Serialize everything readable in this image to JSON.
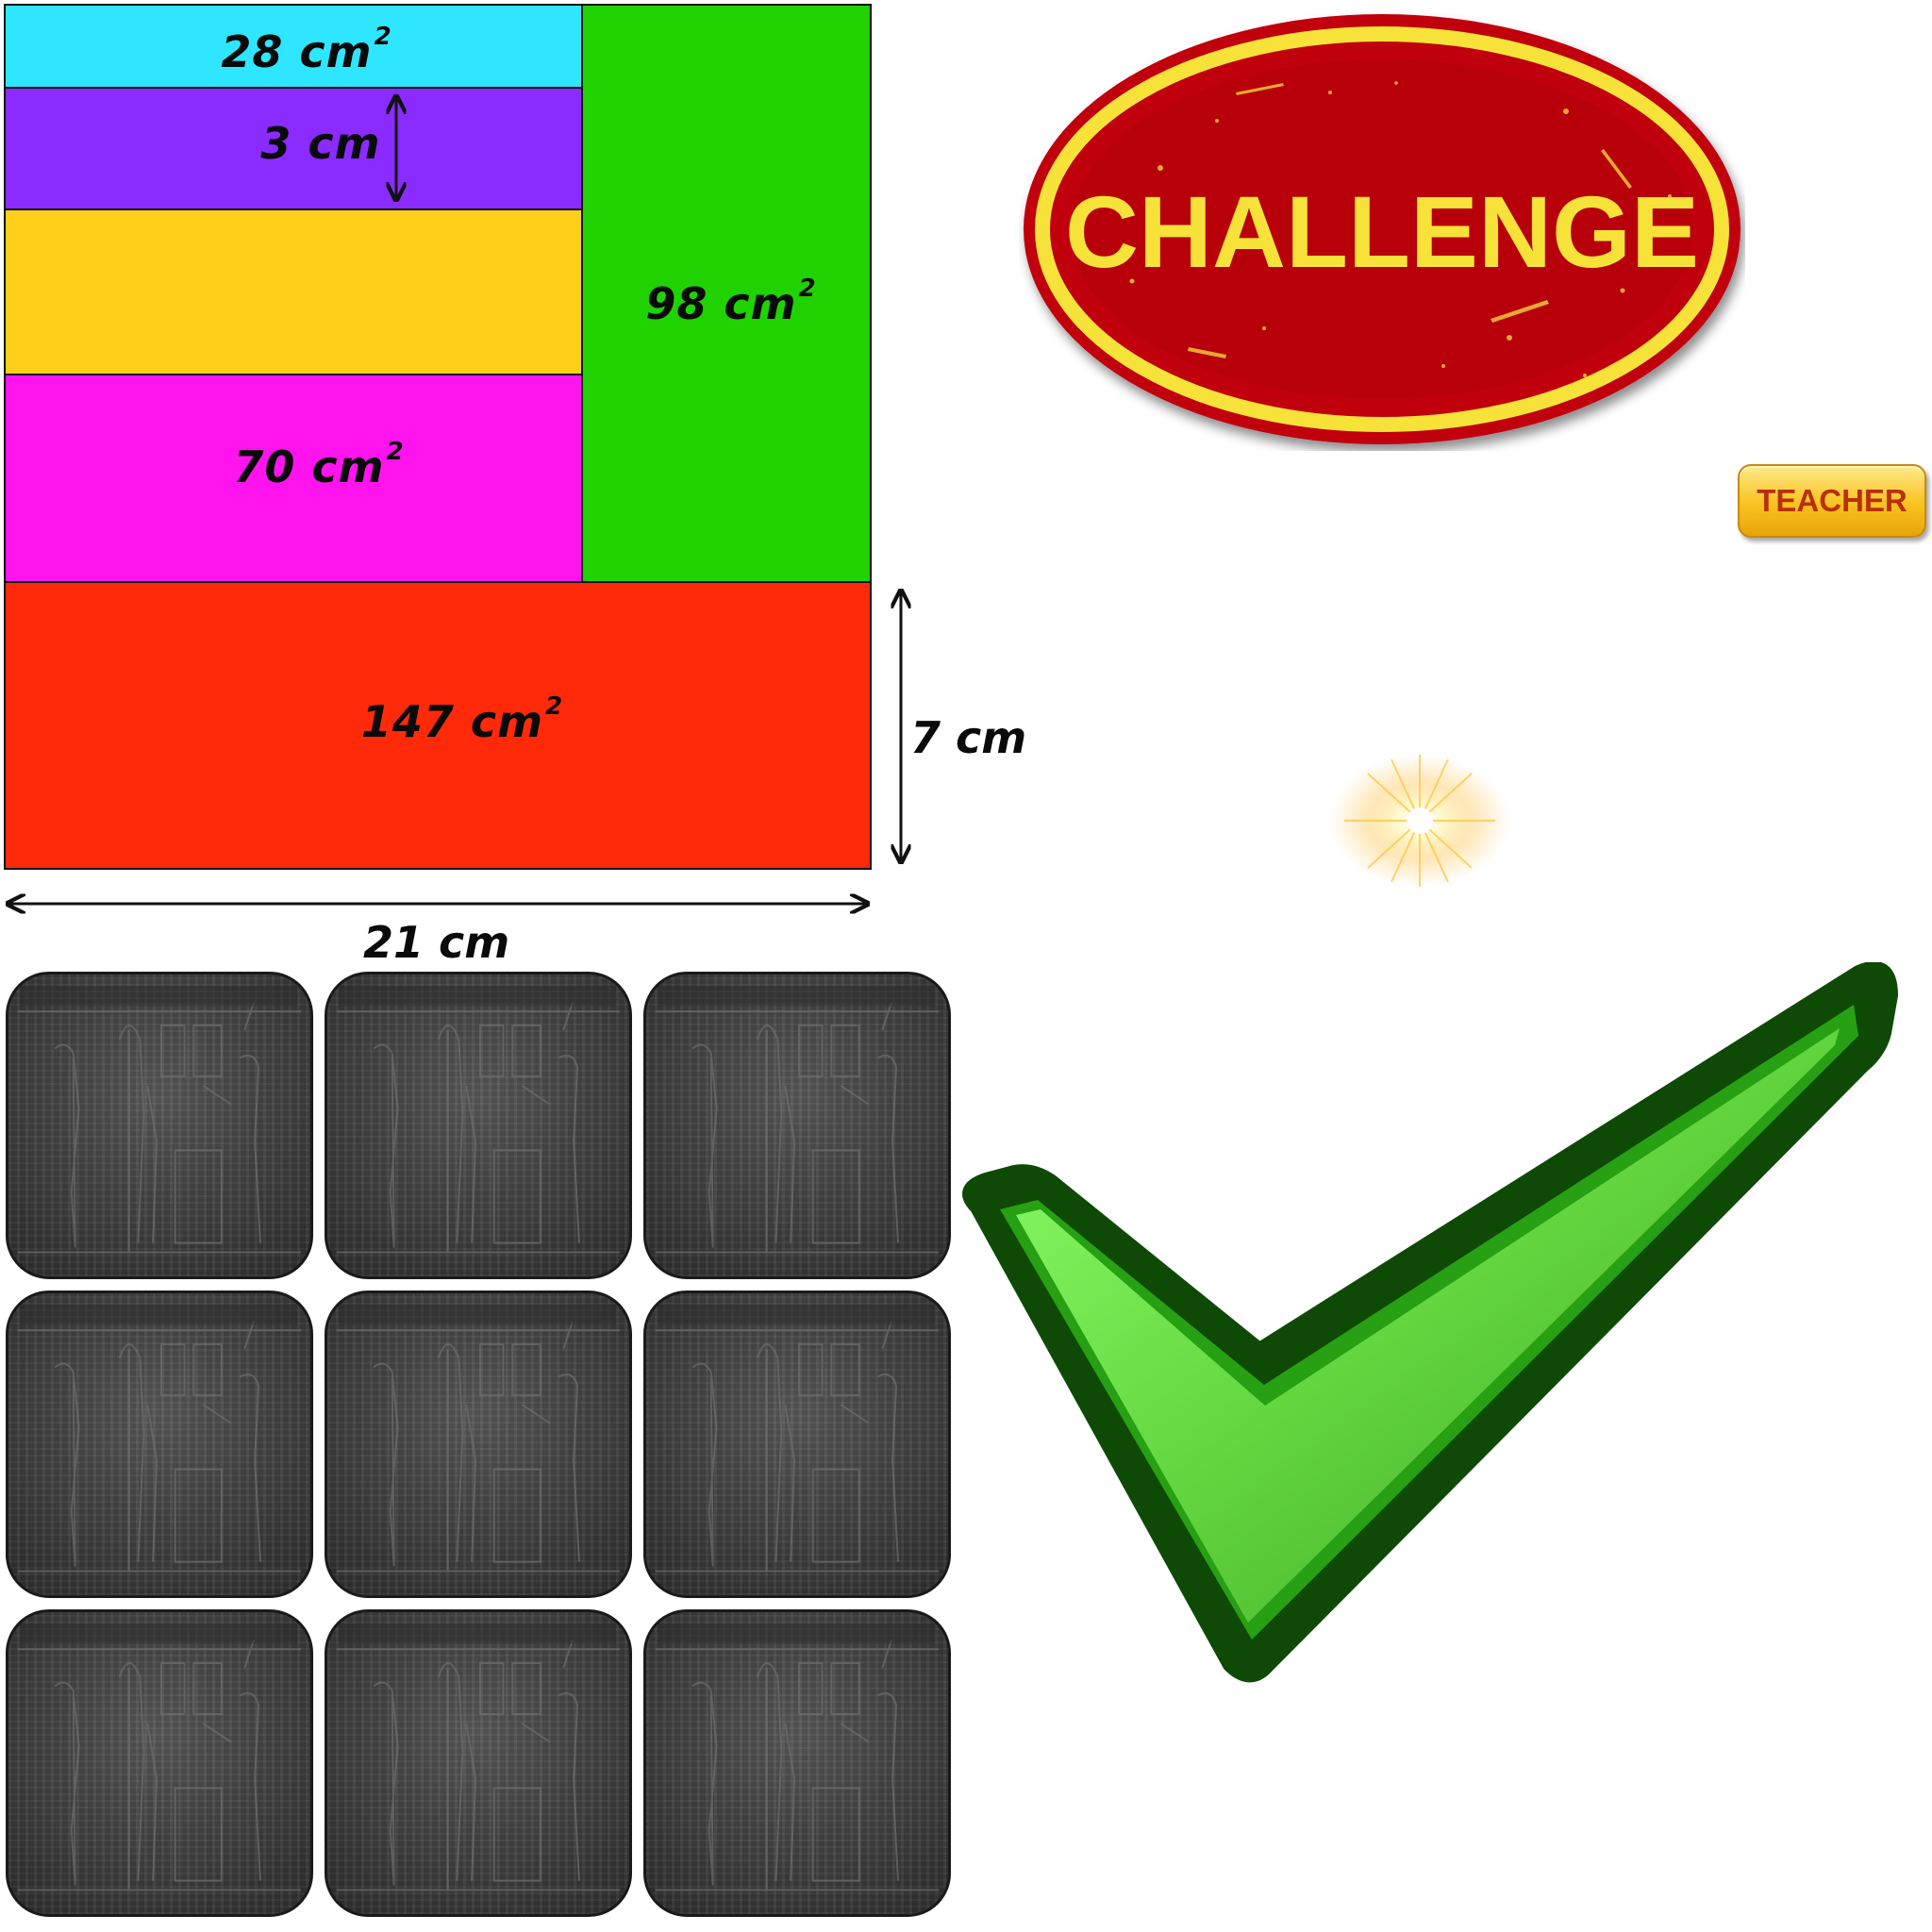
{
  "diagram": {
    "rectangles": [
      {
        "id": "cyan",
        "color": "#2ee6ff",
        "area_label": "28 cm",
        "superscript": "2"
      },
      {
        "id": "purple",
        "color": "#8a2bff",
        "height_label": "3 cm"
      },
      {
        "id": "yellow",
        "color": "#ffcf1a"
      },
      {
        "id": "magenta",
        "color": "#ff14ee",
        "area_label": "70 cm",
        "superscript": "2"
      },
      {
        "id": "green",
        "color": "#1fd200",
        "area_label": "98 cm",
        "superscript": "2"
      },
      {
        "id": "red",
        "color": "#ff2a0a",
        "area_label": "147 cm",
        "superscript": "2"
      }
    ],
    "height_dimension": "7 cm",
    "width_dimension": "21 cm"
  },
  "badge": {
    "text": "CHALLENGE",
    "fill_color": "#c0000b",
    "ring_color": "#f7e23a"
  },
  "teacher_button": {
    "label": "TEACHER"
  },
  "tiles": {
    "count": 9,
    "style": "carved stone relief"
  },
  "checkmark": {
    "icon": "checkmark-icon",
    "color": "#46c21c"
  }
}
